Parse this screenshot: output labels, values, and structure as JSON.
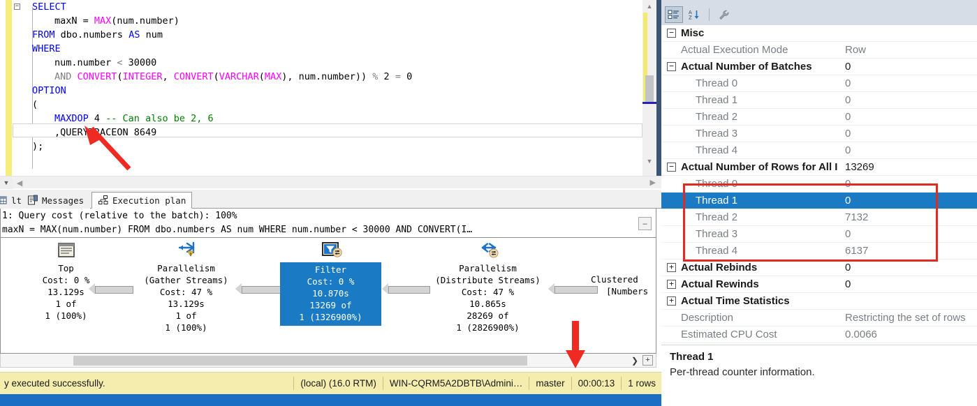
{
  "editor": {
    "code_lines": [
      {
        "indent": 0,
        "fold": true,
        "tokens": [
          {
            "t": "SELECT",
            "c": "kw"
          }
        ]
      },
      {
        "indent": 1,
        "tokens": [
          {
            "t": "maxN = ",
            "c": ""
          },
          {
            "t": "MAX",
            "c": "fn"
          },
          {
            "t": "(num.number)",
            "c": ""
          }
        ]
      },
      {
        "indent": 0,
        "tokens": [
          {
            "t": "FROM",
            "c": "kw"
          },
          {
            "t": " dbo.numbers ",
            "c": ""
          },
          {
            "t": "AS",
            "c": "kw"
          },
          {
            "t": " num",
            "c": ""
          }
        ]
      },
      {
        "indent": 0,
        "tokens": [
          {
            "t": "WHERE",
            "c": "kw"
          }
        ]
      },
      {
        "indent": 1,
        "tokens": [
          {
            "t": "num.number ",
            "c": ""
          },
          {
            "t": "<",
            "c": "op"
          },
          {
            "t": " 30000",
            "c": ""
          }
        ]
      },
      {
        "indent": 1,
        "tokens": [
          {
            "t": "AND",
            "c": "op"
          },
          {
            "t": " ",
            "c": ""
          },
          {
            "t": "CONVERT",
            "c": "fn"
          },
          {
            "t": "(",
            "c": ""
          },
          {
            "t": "INTEGER",
            "c": "fn"
          },
          {
            "t": ", ",
            "c": ""
          },
          {
            "t": "CONVERT",
            "c": "fn"
          },
          {
            "t": "(",
            "c": ""
          },
          {
            "t": "VARCHAR",
            "c": "fn"
          },
          {
            "t": "(",
            "c": ""
          },
          {
            "t": "MAX",
            "c": "fn"
          },
          {
            "t": "), num.number)) ",
            "c": ""
          },
          {
            "t": "%",
            "c": "op"
          },
          {
            "t": " 2 ",
            "c": ""
          },
          {
            "t": "=",
            "c": "op"
          },
          {
            "t": " 0",
            "c": ""
          }
        ]
      },
      {
        "indent": 0,
        "tokens": [
          {
            "t": "OPTION",
            "c": "kw"
          }
        ]
      },
      {
        "indent": 0,
        "tokens": [
          {
            "t": "(",
            "c": ""
          }
        ]
      },
      {
        "indent": 1,
        "tokens": [
          {
            "t": "MAXDOP",
            "c": "kw"
          },
          {
            "t": " 4 ",
            "c": ""
          },
          {
            "t": "-- Can also be 2, 6",
            "c": "cm"
          }
        ]
      },
      {
        "indent": 1,
        "tokens": [
          {
            "t": ",QUERYTRACEON 8649",
            "c": ""
          }
        ]
      },
      {
        "indent": 0,
        "tokens": [
          {
            "t": ");",
            "c": ""
          }
        ]
      }
    ]
  },
  "tabs": [
    {
      "label": "lts",
      "icon": "grid-icon",
      "active": false
    },
    {
      "label": "Messages",
      "icon": "messages-icon",
      "active": false
    },
    {
      "label": "Execution plan",
      "icon": "execution-plan-icon",
      "active": true
    }
  ],
  "plan": {
    "header_line1": "1: Query cost (relative to the batch): 100%",
    "header_line2": "maxN = MAX(num.number) FROM dbo.numbers AS num WHERE num.number < 30000 AND CONVERT(I…",
    "header_line2_prefix": "Γ",
    "collapse_label": "–",
    "nodes": [
      {
        "name": "Top",
        "icon": "top-operator-icon",
        "lines": [
          "Cost: 0 %",
          "13.129s",
          "1 of",
          "1 (100%)"
        ],
        "selected": false
      },
      {
        "name": "Parallelism",
        "subname": "(Gather Streams)",
        "icon": "parallelism-gather-icon",
        "lines": [
          "Cost: 47 %",
          "13.129s",
          "1 of",
          "1 (100%)"
        ],
        "selected": false,
        "warning": true
      },
      {
        "name": "Filter",
        "icon": "filter-operator-icon",
        "lines": [
          "Cost: 0 %",
          "10.870s",
          "13269 of",
          "1 (1326900%)"
        ],
        "selected": true
      },
      {
        "name": "Parallelism",
        "subname": "(Distribute Streams)",
        "icon": "parallelism-distribute-icon",
        "lines": [
          "Cost: 47 %",
          "10.865s",
          "28269 of",
          "1 (2826900%)"
        ],
        "selected": false
      },
      {
        "name": "Clustered",
        "subname": "[Numbers",
        "icon": "clustered-index-icon",
        "lines": [],
        "selected": false,
        "clipped": true
      }
    ],
    "scroll_right_label": "❯",
    "scroll_plus_label": "+"
  },
  "statusbar": {
    "message": "y executed successfully.",
    "server": "(local) (16.0 RTM)",
    "user": "WIN-CQRM5A2DBTB\\Admini…",
    "database": "master",
    "elapsed": "00:00:13",
    "rows": "1 rows"
  },
  "properties": {
    "toolbar": [
      {
        "name": "categorized-view-icon",
        "pressed": true
      },
      {
        "name": "alphabetical-sort-icon",
        "pressed": false
      },
      {
        "name": "property-pages-wrench-icon",
        "pressed": false
      }
    ],
    "rows": [
      {
        "expander": "minus",
        "name": "Misc",
        "value": "",
        "category": true,
        "indent": false,
        "selected": false
      },
      {
        "expander": "none",
        "name": "Actual Execution Mode",
        "value": "Row",
        "category": false,
        "indent": false,
        "selected": false
      },
      {
        "expander": "minus",
        "name": "Actual Number of Batches",
        "value": "0",
        "category": true,
        "indent": false,
        "selected": false
      },
      {
        "expander": "none",
        "name": "Thread 0",
        "value": "0",
        "category": false,
        "indent": true,
        "selected": false
      },
      {
        "expander": "none",
        "name": "Thread 1",
        "value": "0",
        "category": false,
        "indent": true,
        "selected": false
      },
      {
        "expander": "none",
        "name": "Thread 2",
        "value": "0",
        "category": false,
        "indent": true,
        "selected": false
      },
      {
        "expander": "none",
        "name": "Thread 3",
        "value": "0",
        "category": false,
        "indent": true,
        "selected": false
      },
      {
        "expander": "none",
        "name": "Thread 4",
        "value": "0",
        "category": false,
        "indent": true,
        "selected": false
      },
      {
        "expander": "minus",
        "name": "Actual Number of Rows for All I",
        "value": "13269",
        "category": true,
        "indent": false,
        "selected": false
      },
      {
        "expander": "none",
        "name": "Thread 0",
        "value": "0",
        "category": false,
        "indent": true,
        "selected": false
      },
      {
        "expander": "none",
        "name": "Thread 1",
        "value": "0",
        "category": false,
        "indent": true,
        "selected": true
      },
      {
        "expander": "none",
        "name": "Thread 2",
        "value": "7132",
        "category": false,
        "indent": true,
        "selected": false
      },
      {
        "expander": "none",
        "name": "Thread 3",
        "value": "0",
        "category": false,
        "indent": true,
        "selected": false
      },
      {
        "expander": "none",
        "name": "Thread 4",
        "value": "6137",
        "category": false,
        "indent": true,
        "selected": false
      },
      {
        "expander": "plus",
        "name": "Actual Rebinds",
        "value": "0",
        "category": true,
        "indent": false,
        "selected": false
      },
      {
        "expander": "plus",
        "name": "Actual Rewinds",
        "value": "0",
        "category": true,
        "indent": false,
        "selected": false
      },
      {
        "expander": "plus",
        "name": "Actual Time Statistics",
        "value": "",
        "category": true,
        "indent": false,
        "selected": false
      },
      {
        "expander": "none",
        "name": "Description",
        "value": "Restricting the set of rows",
        "category": false,
        "indent": false,
        "selected": false
      },
      {
        "expander": "none",
        "name": "Estimated CPU Cost",
        "value": "0.0066",
        "category": false,
        "indent": false,
        "selected": false
      }
    ],
    "description": {
      "title": "Thread 1",
      "body": "Per-thread counter information."
    }
  },
  "annotations": {
    "highlight_color": "#e02b20",
    "arrow_color": "#ee2b22"
  }
}
